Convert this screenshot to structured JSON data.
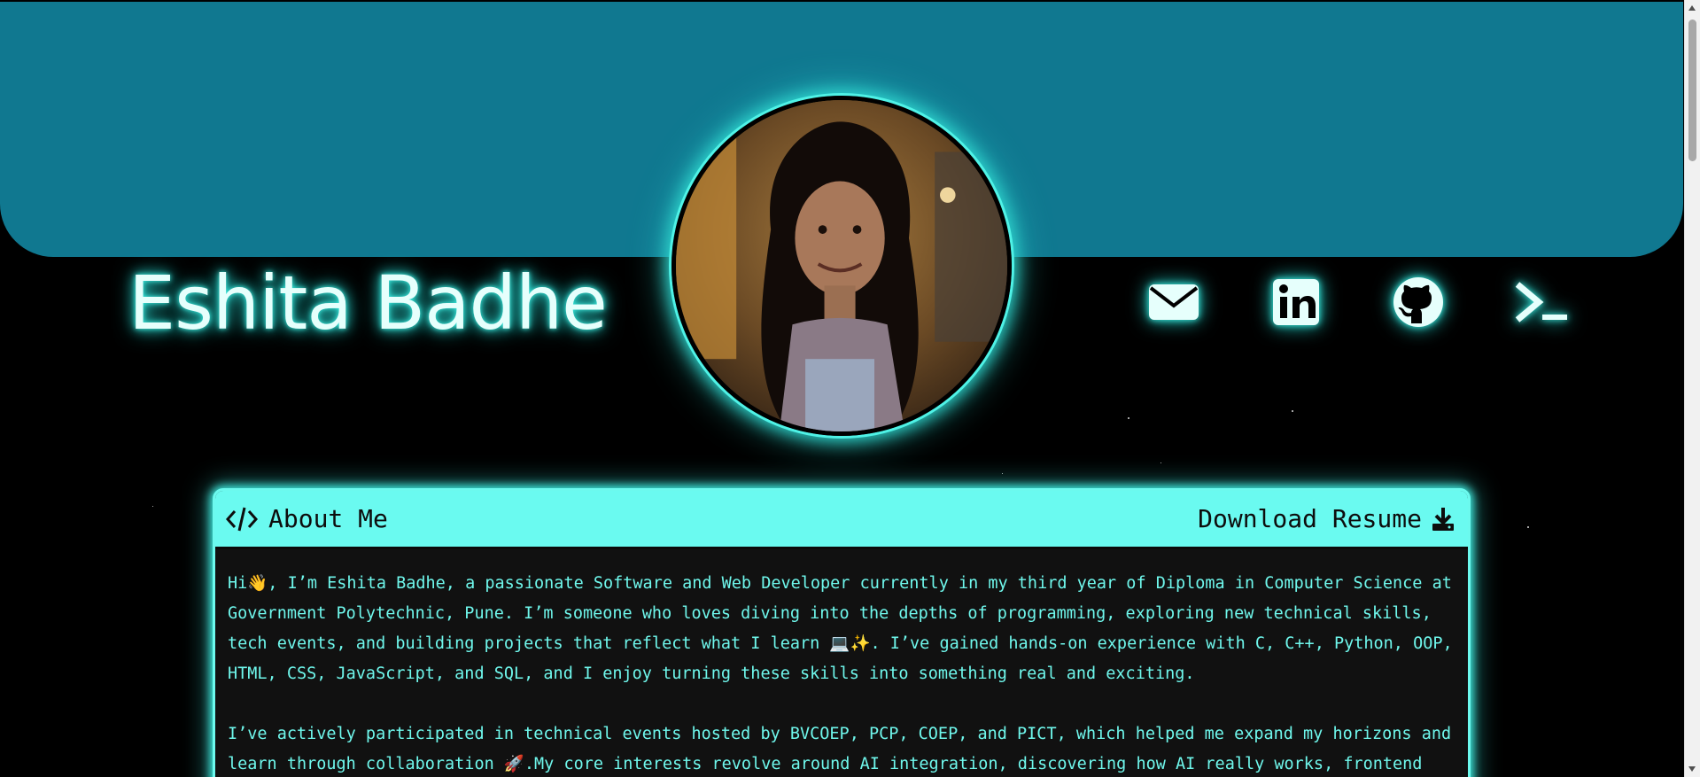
{
  "profile": {
    "name": "Eshita Badhe"
  },
  "social": [
    {
      "name": "email-icon"
    },
    {
      "name": "linkedin-icon"
    },
    {
      "name": "github-icon"
    },
    {
      "name": "terminal-icon"
    }
  ],
  "about": {
    "title": "About Me",
    "download_label": "Download Resume",
    "paragraphs": [
      "Hi👋, I’m Eshita Badhe, a passionate Software and Web Developer currently in my third year of Diploma in Computer Science at Government Polytechnic, Pune. I’m someone who loves diving into the depths of programming, exploring new technical skills, tech events, and building projects that reflect what I learn 💻✨. I’ve gained hands-on experience with C, C++, Python, OOP, HTML, CSS, JavaScript, and SQL, and I enjoy turning these skills into something real and exciting.",
      "I’ve actively participated in technical events hosted by BVCOEP, PCP, COEP, and PICT, which helped me expand my horizons and learn through collaboration 🚀.My core interests revolve around AI integration, discovering how AI really works, frontend"
    ]
  },
  "colors": {
    "banner": "#107890",
    "accent": "#6afaf0",
    "glow": "#3ff5e8",
    "background": "#000000"
  }
}
